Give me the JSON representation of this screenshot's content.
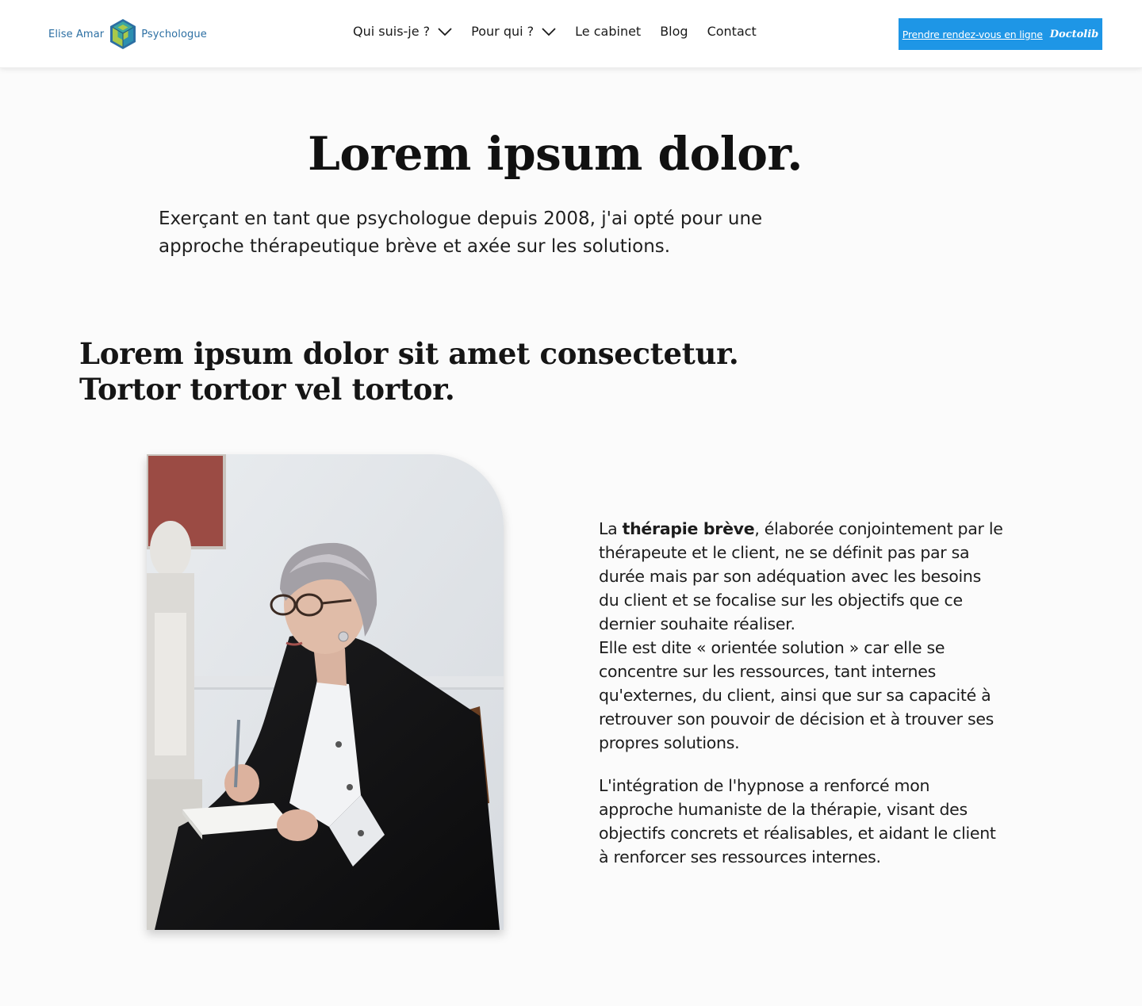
{
  "header": {
    "logo": {
      "name": "Elise Amar",
      "role": "Psychologue",
      "icon": "cube-logo-icon",
      "colors": [
        "#2c6fa3",
        "#3aa6a0",
        "#a9c94a"
      ]
    },
    "nav": [
      {
        "label": "Qui suis-je ?",
        "has_dropdown": true
      },
      {
        "label": "Pour qui ?",
        "has_dropdown": true
      },
      {
        "label": "Le cabinet",
        "has_dropdown": false
      },
      {
        "label": "Blog",
        "has_dropdown": false
      },
      {
        "label": "Contact",
        "has_dropdown": false
      }
    ],
    "cta": {
      "label": "Prendre rendez-vous en ligne",
      "brand": "Doctolib",
      "color": "#1e96e6"
    }
  },
  "hero": {
    "title": "Lorem ipsum dolor.",
    "intro": "Exerçant en tant que psychologue depuis 2008, j'ai opté pour une approche thérapeutique brève et axée sur les solutions."
  },
  "section": {
    "heading_line1": "Lorem ipsum dolor sit amet consectetur.",
    "heading_line2": "Tortor tortor vel tortor.",
    "photo_alt": "Woman with glasses taking notes in an armchair",
    "paragraph1": {
      "prefix": "La ",
      "bold": "thérapie brève",
      "rest": ", élaborée conjointement par le thérapeute et le client, ne se définit pas par sa durée mais par son adéquation avec les besoins du client et se focalise sur les objectifs que ce dernier souhaite réaliser.",
      "second_line": "Elle est dite « orientée solution » car elle se concentre sur les ressources, tant internes qu'externes, du client, ainsi que sur sa capacité à retrouver son pouvoir de décision et à trouver ses propres solutions."
    },
    "paragraph2": "L'intégration de l'hypnose a renforcé mon approche humaniste de la thérapie, visant des objectifs concrets et réalisables, et aidant le client à renforcer ses ressources internes."
  }
}
